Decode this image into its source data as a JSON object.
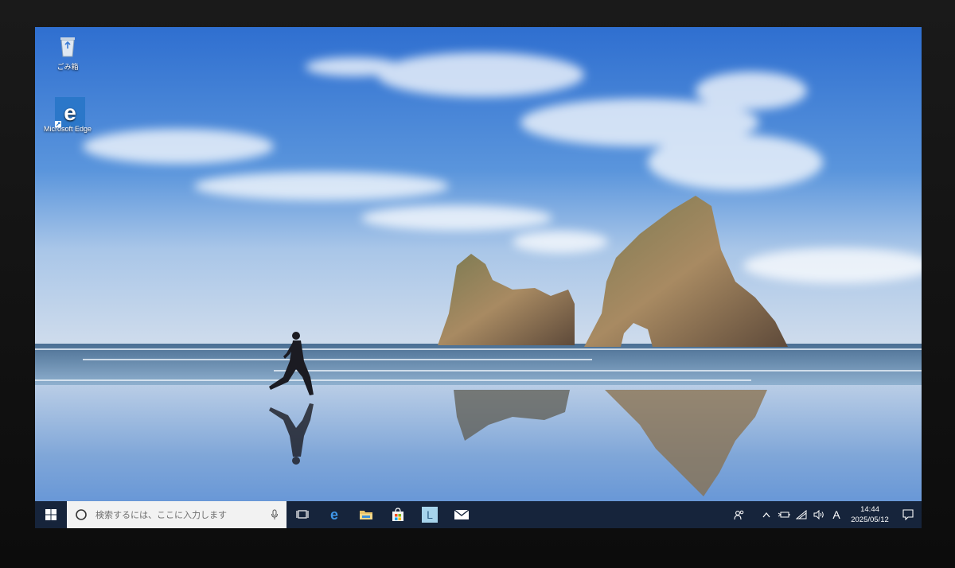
{
  "desktop": {
    "icons": [
      {
        "label": "ごみ箱",
        "icon": "recycle-bin-icon"
      },
      {
        "label": "Microsoft Edge",
        "icon": "edge-icon"
      }
    ]
  },
  "taskbar": {
    "search_placeholder": "検索するには、ここに入力します",
    "pinned": [
      "task-view-icon",
      "edge-icon",
      "file-explorer-icon",
      "store-icon",
      "app-l-icon",
      "mail-icon"
    ],
    "app_l_letter": "L",
    "ime_indicator": "A",
    "clock": {
      "time": "14:44",
      "date": "2025/05/12"
    },
    "accent": "#16243b"
  }
}
